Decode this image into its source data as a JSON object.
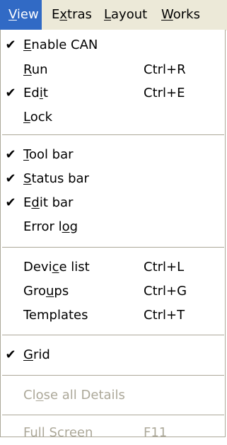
{
  "menubar": {
    "items": [
      {
        "label_pre": "",
        "label_ul": "V",
        "label_post": "iew"
      },
      {
        "label_pre": "E",
        "label_ul": "x",
        "label_post": "tras"
      },
      {
        "label_pre": "",
        "label_ul": "L",
        "label_post": "ayout"
      },
      {
        "label_pre": "",
        "label_ul": "W",
        "label_post": "orks"
      }
    ]
  },
  "dropdown": {
    "items": [
      {
        "check": "✔",
        "pre": "",
        "ul": "E",
        "post": "nable CAN",
        "shortcut": ""
      },
      {
        "check": "",
        "pre": "",
        "ul": "R",
        "post": "un",
        "shortcut": "Ctrl+R"
      },
      {
        "check": "✔",
        "pre": "Ed",
        "ul": "i",
        "post": "t",
        "shortcut": "Ctrl+E"
      },
      {
        "check": "",
        "pre": "",
        "ul": "L",
        "post": "ock",
        "shortcut": ""
      },
      {
        "check": "✔",
        "pre": "",
        "ul": "T",
        "post": "ool bar",
        "shortcut": ""
      },
      {
        "check": "✔",
        "pre": "",
        "ul": "S",
        "post": "tatus bar",
        "shortcut": ""
      },
      {
        "check": "✔",
        "pre": "E",
        "ul": "d",
        "post": "it bar",
        "shortcut": ""
      },
      {
        "check": "",
        "pre": "Error l",
        "ul": "o",
        "post": "g",
        "shortcut": ""
      },
      {
        "check": "",
        "pre": "Devi",
        "ul": "c",
        "post": "e list",
        "shortcut": "Ctrl+L"
      },
      {
        "check": "",
        "pre": "Gro",
        "ul": "u",
        "post": "ps",
        "shortcut": "Ctrl+G"
      },
      {
        "check": "",
        "pre": "Templates",
        "ul": "",
        "post": "",
        "shortcut": "Ctrl+T"
      },
      {
        "check": "✔",
        "pre": "",
        "ul": "G",
        "post": "rid",
        "shortcut": ""
      },
      {
        "check": "",
        "pre": "Cl",
        "ul": "o",
        "post": "se all Details",
        "shortcut": ""
      },
      {
        "check": "",
        "pre": "Full Screen",
        "ul": "",
        "post": "",
        "shortcut": "F11"
      }
    ]
  }
}
